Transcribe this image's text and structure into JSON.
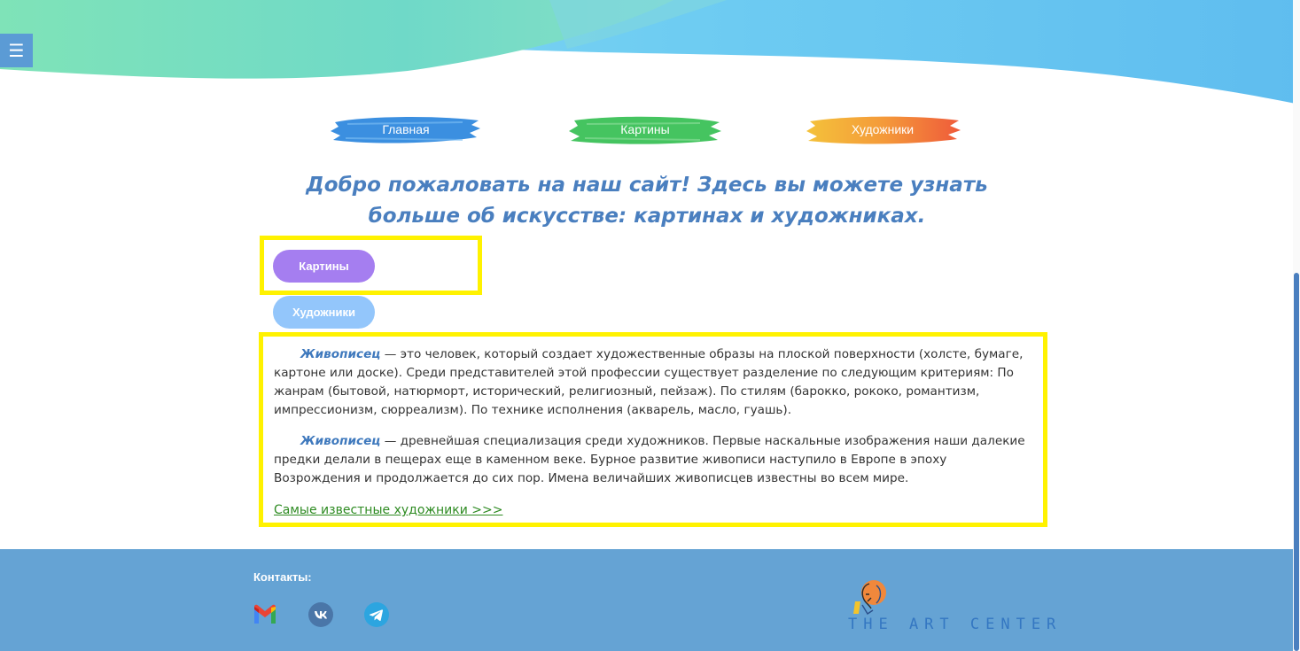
{
  "header": {
    "menu_icon": "☰"
  },
  "nav": {
    "items": [
      {
        "label": "Главная",
        "color": "#3b8fe0"
      },
      {
        "label": "Картины",
        "color": "#45c460"
      },
      {
        "label": "Художники",
        "color": "#f08a3a"
      }
    ]
  },
  "welcome": {
    "text": "Добро пожаловать на наш сайт! Здесь вы можете узнать больше об искусстве: картинах и художниках."
  },
  "tabs": {
    "paintings_label": "Картины",
    "artists_label": "Художники"
  },
  "content": {
    "p1_term": "Живописец",
    "p1_text": " — это человек, который создает художественные образы на плоской поверхности (холсте, бумаге, картоне или доске). Среди представителей этой профессии существует разделение по следующим критериям: По жанрам (бытовой, натюрморт, исторический, религиозный, пейзаж). По стилям (барокко, рококо, романтизм, импрессионизм, сюрреализм). По технике исполнения (акварель, масло, гуашь).",
    "p2_term": "Живописец",
    "p2_text": " — древнейшая специализация среди художников. Первые наскальные изображения наши далекие предки делали в пещерах еще в каменном веке. Бурное развитие живописи наступило в Европе в эпоху Возрождения и продолжается до сих пор. Имена величайших живописцев известны во всем мире.",
    "link_label": "Самые известные художники >>>"
  },
  "footer": {
    "contacts_label": "Контакты:",
    "social_icons": [
      "gmail-icon",
      "vk-icon",
      "telegram-icon"
    ],
    "logo_text": "THE ART CENTER"
  },
  "colors": {
    "accent_blue": "#4a7fbf",
    "highlight_yellow": "#fff200",
    "footer_bg": "#65a3d4",
    "pill_purple": "#a57ef0",
    "pill_lightblue": "#93c6fb",
    "link_green": "#2e8b22"
  }
}
